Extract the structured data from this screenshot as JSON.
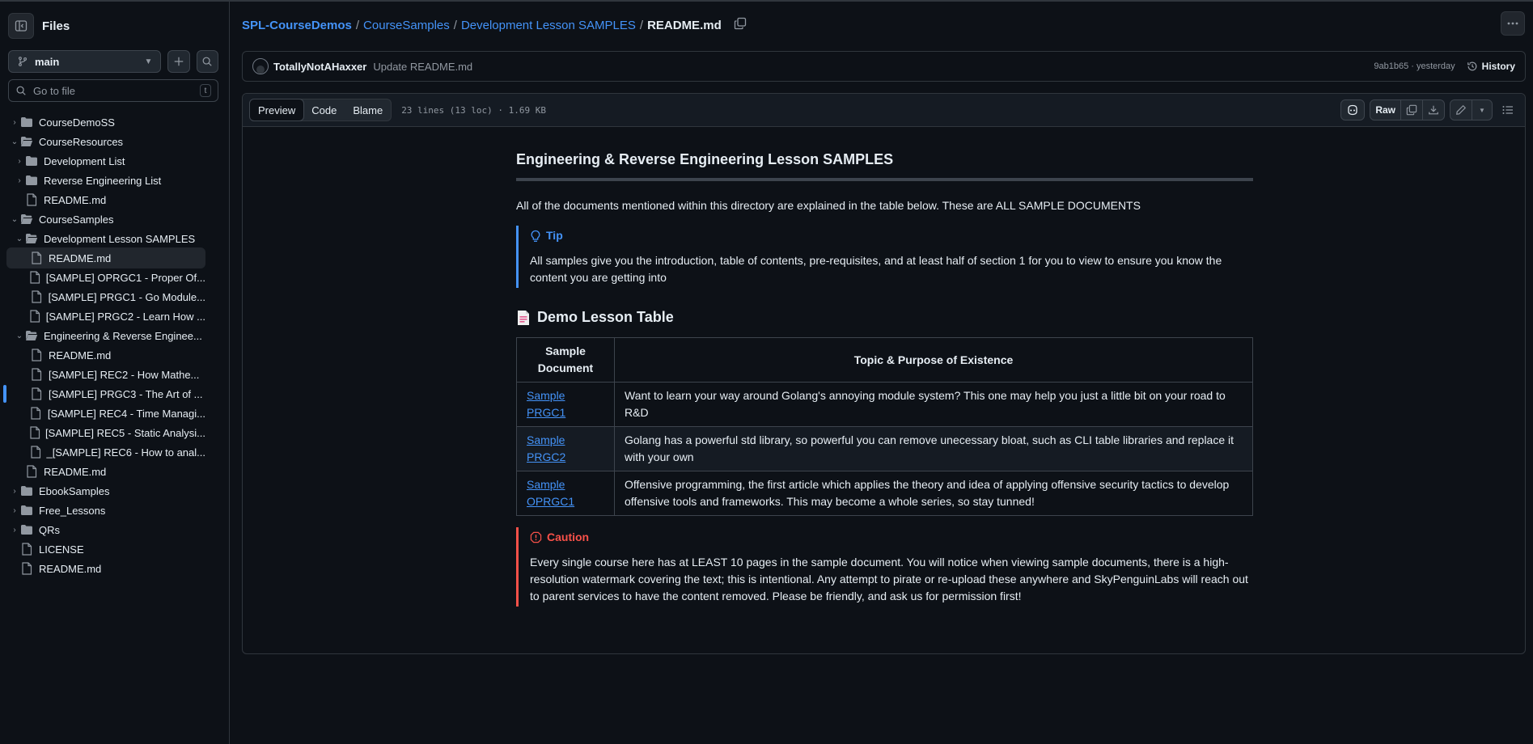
{
  "sidebar": {
    "title": "Files",
    "branch": "main",
    "goto_placeholder": "Go to file",
    "goto_shortcut": "t",
    "tree": [
      {
        "label": "CourseDemoSS"
      },
      {
        "label": "CourseResources"
      },
      {
        "label": "Development List"
      },
      {
        "label": "Reverse Engineering List"
      },
      {
        "label": "README.md"
      },
      {
        "label": "CourseSamples"
      },
      {
        "label": "Development Lesson SAMPLES"
      },
      {
        "label": "README.md"
      },
      {
        "label": "[SAMPLE] OPRGC1 - Proper Of..."
      },
      {
        "label": "[SAMPLE] PRGC1 - Go Module..."
      },
      {
        "label": "[SAMPLE] PRGC2 - Learn How ..."
      },
      {
        "label": "Engineering & Reverse Enginee..."
      },
      {
        "label": "README.md"
      },
      {
        "label": "[SAMPLE] REC2 - How Mathe..."
      },
      {
        "label": "[SAMPLE] PRGC3 - The Art of ..."
      },
      {
        "label": "[SAMPLE] REC4 - Time Managi..."
      },
      {
        "label": "[SAMPLE] REC5 - Static Analysi..."
      },
      {
        "label": "_[SAMPLE] REC6 - How to anal..."
      },
      {
        "label": "README.md"
      },
      {
        "label": "EbookSamples"
      },
      {
        "label": "Free_Lessons"
      },
      {
        "label": "QRs"
      },
      {
        "label": "LICENSE"
      },
      {
        "label": "README.md"
      }
    ]
  },
  "breadcrumb": {
    "repo": "SPL-CourseDemos",
    "sep": "/",
    "dir1": "CourseSamples",
    "dir2": "Development Lesson SAMPLES",
    "file": "README.md"
  },
  "commit": {
    "author": "TotallyNotAHaxxer",
    "message": "Update README.md",
    "sha_time": "9ab1b65 · yesterday",
    "history_label": "History"
  },
  "file_header": {
    "tabs": [
      "Preview",
      "Code",
      "Blame"
    ],
    "active_tab": "Preview",
    "lines_info": "23 lines (13 loc) · 1.69 KB",
    "raw_label": "Raw"
  },
  "readme": {
    "title": "Engineering & Reverse Engineering Lesson SAMPLES",
    "intro": "All of the documents mentioned within this directory are explained in the table below. These are ALL SAMPLE DOCUMENTS",
    "tip_label": "Tip",
    "tip_text": "All samples give you the introduction, table of contents, pre-requisites, and at least half of section 1 for you to view to ensure you know the content you are getting into",
    "table_heading": "Demo Lesson Table",
    "table_headers": [
      "Sample Document",
      "Topic & Purpose of Existence"
    ],
    "rows": [
      {
        "doc": "Sample PRGC1",
        "topic": "Want to learn your way around Golang's annoying module system? This one may help you just a little bit on your road to R&D"
      },
      {
        "doc": "Sample PRGC2",
        "topic": "Golang has a powerful std library, so powerful you can remove unecessary bloat, such as CLI table libraries and replace it with your own"
      },
      {
        "doc": "Sample OPRGC1",
        "topic": "Offensive programming, the first article which applies the theory and idea of applying offensive security tactics to develop offensive tools and frameworks. This may become a whole series, so stay tunned!"
      }
    ],
    "caution_label": "Caution",
    "caution_text": "Every single course here has at LEAST 10 pages in the sample document. You will notice when viewing sample documents, there is a high-resolution watermark covering the text; this is intentional. Any attempt to pirate or re-upload these anywhere and SkyPenguinLabs will reach out to parent services to have the content removed. Please be friendly, and ask us for permission first!"
  },
  "colors": {
    "background": "#0d1117",
    "link": "#4493f8",
    "tip": "#4493f8",
    "caution": "#f85149",
    "border": "#30363d"
  }
}
